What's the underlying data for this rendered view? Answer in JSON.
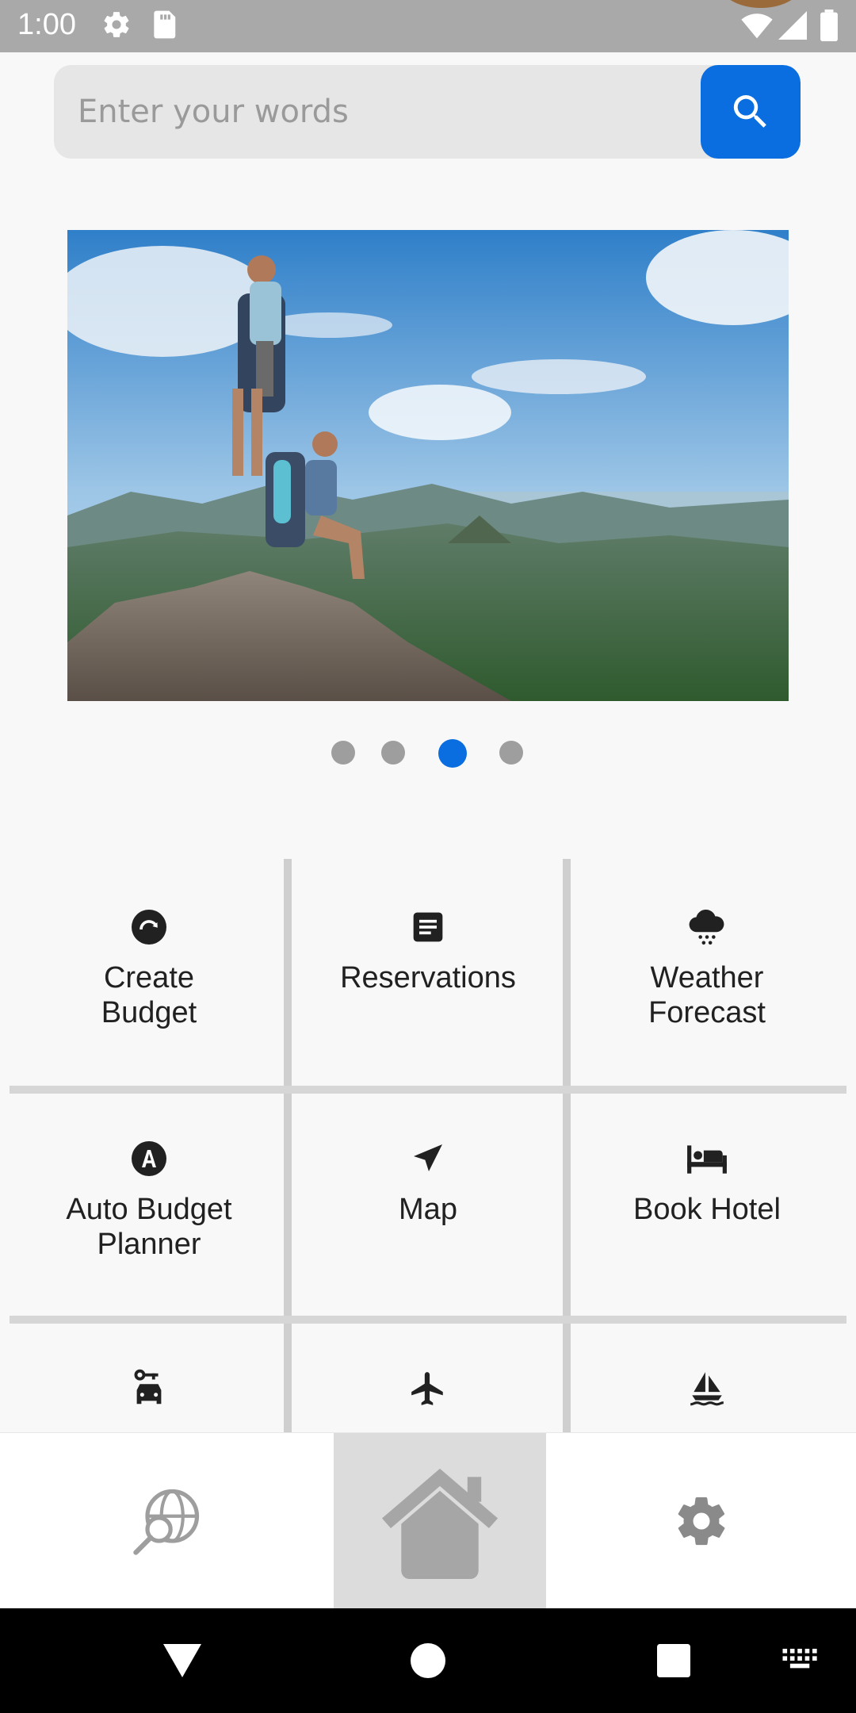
{
  "status_bar": {
    "time": "1:00"
  },
  "search": {
    "placeholder": "Enter your words"
  },
  "carousel": {
    "slide_count": 4,
    "active_index": 2
  },
  "grid": {
    "items": [
      {
        "label": "Create\nBudget",
        "icon": "budget-icon"
      },
      {
        "label": "Reservations",
        "icon": "document-icon"
      },
      {
        "label": "Weather\nForecast",
        "icon": "snow-cloud-icon"
      },
      {
        "label": "Auto Budget\nPlanner",
        "icon": "letter-a-circle-icon"
      },
      {
        "label": "Map",
        "icon": "navigation-arrow-icon"
      },
      {
        "label": "Book Hotel",
        "icon": "hotel-bed-icon"
      },
      {
        "label": "",
        "icon": "car-rental-icon"
      },
      {
        "label": "",
        "icon": "airplane-icon"
      },
      {
        "label": "",
        "icon": "sailboat-icon"
      }
    ]
  },
  "bottom_nav": {
    "items": [
      {
        "name": "explore",
        "icon": "globe-search-icon"
      },
      {
        "name": "home",
        "icon": "home-icon",
        "active": true
      },
      {
        "name": "settings",
        "icon": "gear-icon"
      }
    ]
  },
  "colors": {
    "accent": "#0a6ee0",
    "status_bar": "#a9a9a9",
    "divider": "#d0d0d0"
  }
}
